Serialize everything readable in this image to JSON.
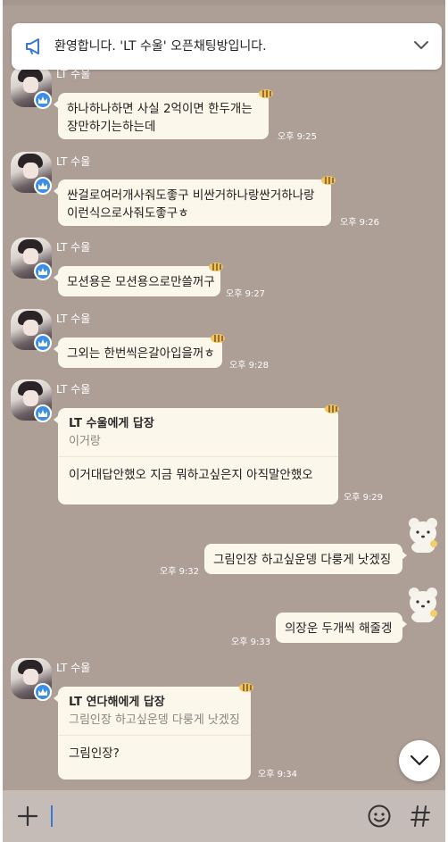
{
  "notice": {
    "text": "환영합니다. 'LT 수울' 오픈채팅방입니다.",
    "icon": "megaphone-icon",
    "toggle_icon": "chevron-down-icon"
  },
  "messages": [
    {
      "sender": "LT 수울",
      "lines": [
        "하나하나하면 사실 2억이면 한두개는",
        "장만하기는하는데"
      ],
      "time": "오후 9:25"
    },
    {
      "sender": "LT 수울",
      "lines": [
        "싼걸로여러개사줘도좋구 비싼거하나랑싼거하나랑",
        "이런식으로사줘도좋구ㅎ"
      ],
      "time": "오후 9:26"
    },
    {
      "sender": "LT 수울",
      "lines": [
        "모션용은 모션용으로만쓸꺼구"
      ],
      "time": "오후 9:27"
    },
    {
      "sender": "LT 수울",
      "lines": [
        "그외는 한번씩은갈아입을꺼ㅎ"
      ],
      "time": "오후 9:28"
    },
    {
      "sender": "LT 수울",
      "reply_title": "LT 수울에게 답장",
      "reply_quote": "이거랑",
      "body": "이거대답안했오 지금 뭐하고싶은지 아직말안했오",
      "time": "오후 9:29"
    },
    {
      "sender": "LT 수울",
      "reply_title": "LT 연다해에게 답장",
      "reply_quote": "그림인장 하고싶운뎅 다룽게 낫겠징",
      "body": "그림인장?",
      "time": "오후 9:34"
    }
  ],
  "my_messages": [
    {
      "text": "그림인장 하고싶운뎅 다룽게 낫겠징",
      "time": "오후 9:32"
    },
    {
      "text": "의장운 두개씩 해줄겡",
      "time": "오후 9:33"
    }
  ],
  "input": {
    "plus_icon": "plus-icon",
    "emoji_icon": "emoji-icon",
    "hash_icon": "hash-icon"
  },
  "colors": {
    "chat_background": "#ad9e96",
    "bubble": "#fbf7ea",
    "input_bar": "#c6bcb7",
    "caret": "#3a78d6",
    "crown_badge": "#3b8fe6"
  }
}
